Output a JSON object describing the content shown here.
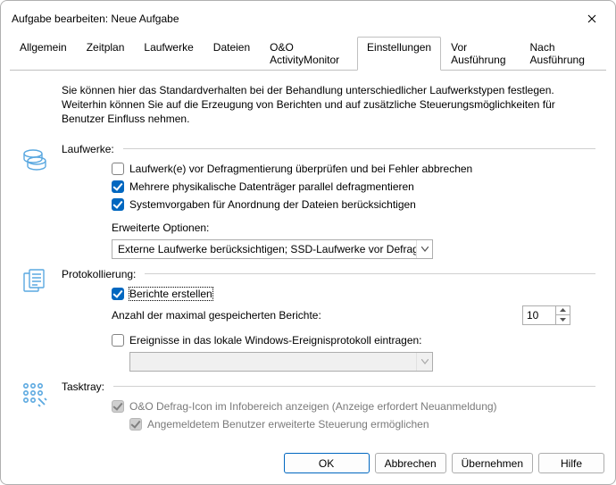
{
  "window": {
    "title": "Aufgabe bearbeiten: Neue Aufgabe"
  },
  "tabs": {
    "t0": "Allgemein",
    "t1": "Zeitplan",
    "t2": "Laufwerke",
    "t3": "Dateien",
    "t4": "O&O ActivityMonitor",
    "t5": "Einstellungen",
    "t6": "Vor Ausführung",
    "t7": "Nach Ausführung"
  },
  "intro": "Sie können hier das Standardverhalten bei der Behandlung unterschiedlicher Laufwerkstypen festlegen. Weiterhin können Sie auf die Erzeugung von Berichten und auf zusätzliche Steuerungsmöglichkeiten für Benutzer Einfluss nehmen.",
  "drives": {
    "heading": "Laufwerke:",
    "c1": "Laufwerk(e) vor Defragmentierung überprüfen und bei Fehler abbrechen",
    "c2": "Mehrere physikalische Datenträger parallel defragmentieren",
    "c3": "Systemvorgaben für Anordnung der Dateien berücksichtigen",
    "advLabel": "Erweiterte Optionen:",
    "advValue": "Externe Laufwerke berücksichtigen; SSD-Laufwerke vor Defragm..."
  },
  "logging": {
    "heading": "Protokollierung:",
    "c1": "Berichte erstellen",
    "maxLabel": "Anzahl der maximal gespeicherten Berichte:",
    "maxValue": "10",
    "c2": "Ereignisse in das lokale Windows-Ereignisprotokoll eintragen:"
  },
  "tray": {
    "heading": "Tasktray:",
    "c1": "O&O Defrag-Icon im Infobereich anzeigen (Anzeige erfordert Neuanmeldung)",
    "c2": "Angemeldetem Benutzer erweiterte Steuerung ermöglichen"
  },
  "buttons": {
    "ok": "OK",
    "cancel": "Abbrechen",
    "apply": "Übernehmen",
    "help": "Hilfe"
  }
}
